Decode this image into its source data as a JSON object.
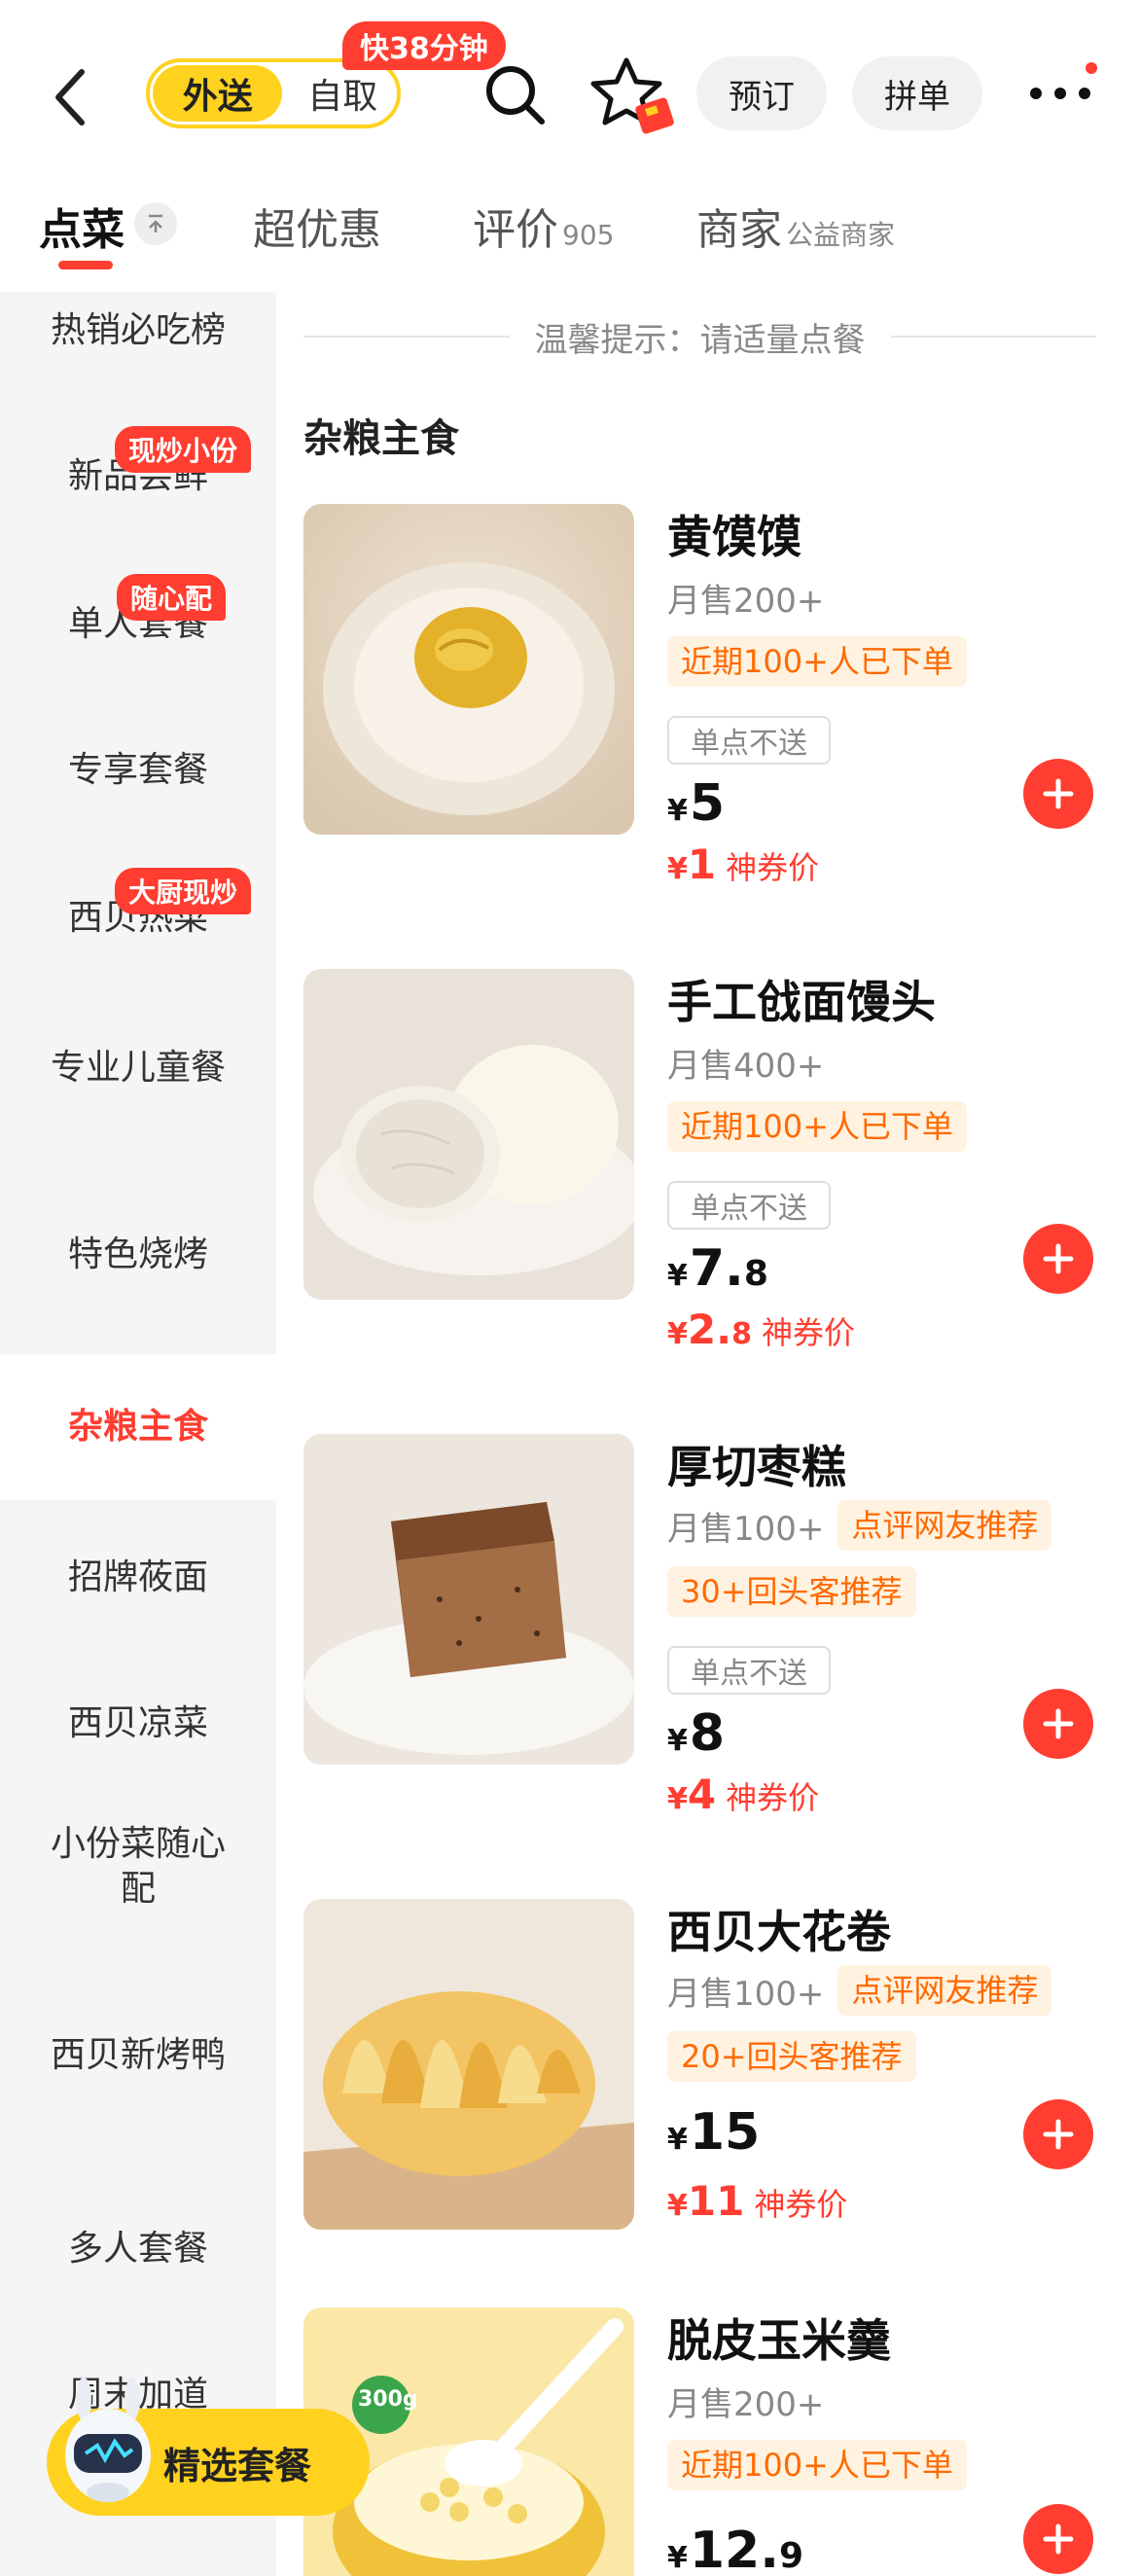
{
  "header": {
    "mode_options": [
      "外送",
      "自取"
    ],
    "speed_badge": "快38分钟",
    "reserve_label": "预订",
    "group_label": "拼单",
    "icons": [
      "back-arrow-icon",
      "search-icon",
      "favorite-star-icon",
      "more-icon"
    ]
  },
  "tabs": [
    {
      "label": "点菜",
      "sub": ""
    },
    {
      "label": "超优惠",
      "sub": ""
    },
    {
      "label": "评价",
      "sub": "905"
    },
    {
      "label": "商家",
      "sub": "公益商家"
    }
  ],
  "sidebar": {
    "items": [
      {
        "label": "热销必吃榜",
        "badge": ""
      },
      {
        "label": "新品尝鲜",
        "badge": "现炒小份"
      },
      {
        "label": "单人套餐",
        "badge": "随心配"
      },
      {
        "label": "专享套餐",
        "badge": ""
      },
      {
        "label": "西贝热菜",
        "badge": "大厨现炒"
      },
      {
        "label": "专业儿童餐",
        "badge": ""
      },
      {
        "label": "特色烧烤",
        "badge": ""
      },
      {
        "label": "杂粮主食",
        "badge": ""
      },
      {
        "label": "招牌莜面",
        "badge": ""
      },
      {
        "label": "西贝凉菜",
        "badge": ""
      },
      {
        "label": "小份菜随心配",
        "badge": ""
      },
      {
        "label": "西贝新烤鸭",
        "badge": ""
      },
      {
        "label": "多人套餐",
        "badge": ""
      },
      {
        "label": "周末加道",
        "badge": ""
      }
    ],
    "active_index": 7
  },
  "content": {
    "tip": "温馨提示：请适量点餐",
    "section_title": "杂粮主食",
    "items": [
      {
        "name": "黄馍馍",
        "sales": "月售200+",
        "tags": [
          "近期100+人已下单"
        ],
        "no_delivery": "单点不送",
        "price_int": "5",
        "price_dec": "",
        "coupon_int": "1",
        "coupon_dec": "",
        "coupon_label": "神券价",
        "currency": "¥"
      },
      {
        "name": "手工戗面馒头",
        "sales": "月售400+",
        "tags": [
          "近期100+人已下单"
        ],
        "no_delivery": "单点不送",
        "price_int": "7.",
        "price_dec": "8",
        "coupon_int": "2.",
        "coupon_dec": "8",
        "coupon_label": "神券价",
        "currency": "¥"
      },
      {
        "name": "厚切枣糕",
        "sales": "月售100+",
        "tags": [
          "点评网友推荐",
          "30+回头客推荐"
        ],
        "no_delivery": "单点不送",
        "price_int": "8",
        "price_dec": "",
        "coupon_int": "4",
        "coupon_dec": "",
        "coupon_label": "神券价",
        "currency": "¥"
      },
      {
        "name": "西贝大花卷",
        "sales": "月售100+",
        "tags": [
          "点评网友推荐",
          "20+回头客推荐"
        ],
        "no_delivery": "",
        "price_int": "15",
        "price_dec": "",
        "coupon_int": "11",
        "coupon_dec": "",
        "coupon_label": "神券价",
        "currency": "¥"
      },
      {
        "name": "脱皮玉米羹",
        "sales": "月售200+",
        "tags": [
          "近期100+人已下单"
        ],
        "no_delivery": "",
        "price_int": "12.",
        "price_dec": "9",
        "coupon_int": "",
        "coupon_dec": "",
        "coupon_label": "",
        "currency": "¥",
        "badge": "300g"
      }
    ]
  },
  "promo": {
    "label": "精选套餐"
  },
  "colors": {
    "accent": "#ff3d30",
    "brand_yellow": "#ffd21f",
    "tag_orange": "#ff6a00"
  }
}
